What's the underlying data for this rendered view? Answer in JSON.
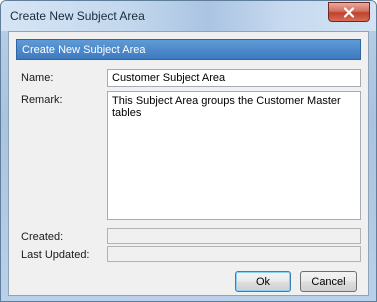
{
  "window": {
    "title": "Create New Subject Area"
  },
  "dialog": {
    "header": "Create New Subject Area",
    "name_label": "Name:",
    "name_value": "Customer Subject Area",
    "remark_label": "Remark:",
    "remark_value": "This Subject Area groups the Customer Master tables",
    "created_label": "Created:",
    "created_value": "",
    "last_updated_label": "Last Updated:",
    "last_updated_value": ""
  },
  "buttons": {
    "ok_label": "Ok",
    "cancel_label": "Cancel"
  },
  "icons": {
    "close": "close-icon"
  }
}
